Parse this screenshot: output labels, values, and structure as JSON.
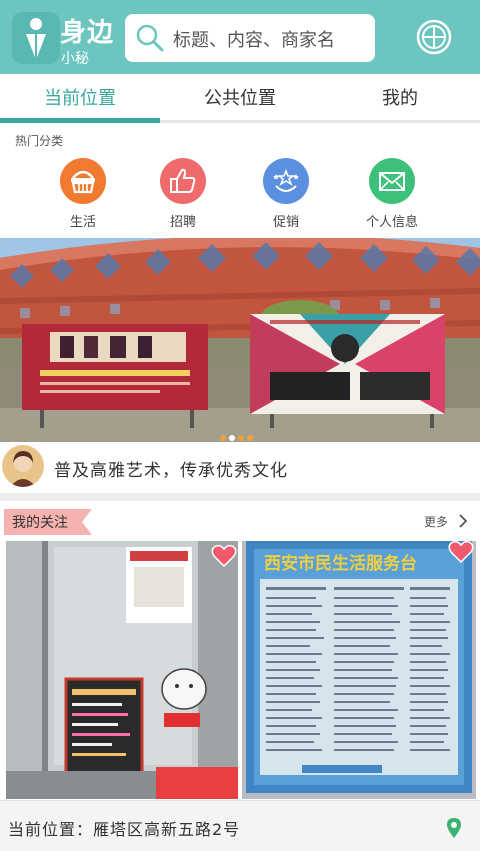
{
  "header": {
    "brand_title": "身边",
    "brand_sub": "小秘",
    "search_placeholder": "标题、内容、商家名",
    "accent_color": "#6cc5bf"
  },
  "tabs": [
    {
      "label": "当前位置",
      "active": true
    },
    {
      "label": "公共位置",
      "active": false
    },
    {
      "label": "我的",
      "active": false
    }
  ],
  "hot": {
    "label": "热门分类",
    "categories": [
      {
        "label": "生活",
        "icon": "basket-icon",
        "color": "#f07a30"
      },
      {
        "label": "招聘",
        "icon": "thumbs-up-icon",
        "color": "#ef6b6b"
      },
      {
        "label": "促销",
        "icon": "stars-icon",
        "color": "#5b8fe0"
      },
      {
        "label": "个人信息",
        "icon": "mail-icon",
        "color": "#3cc07a"
      }
    ]
  },
  "banner": {
    "slides": 4,
    "active_slide": 2
  },
  "notice": {
    "text": "普及高雅艺术，传承优秀文化"
  },
  "follow": {
    "label": "我的关注",
    "more": "更多"
  },
  "cards": [
    {
      "type": "shop-entrance-photo"
    },
    {
      "type": "notice-board-photo",
      "board_title": "西安市民生活服务台"
    }
  ],
  "location": {
    "text": "当前位置：雁塔区高新五路2号"
  }
}
